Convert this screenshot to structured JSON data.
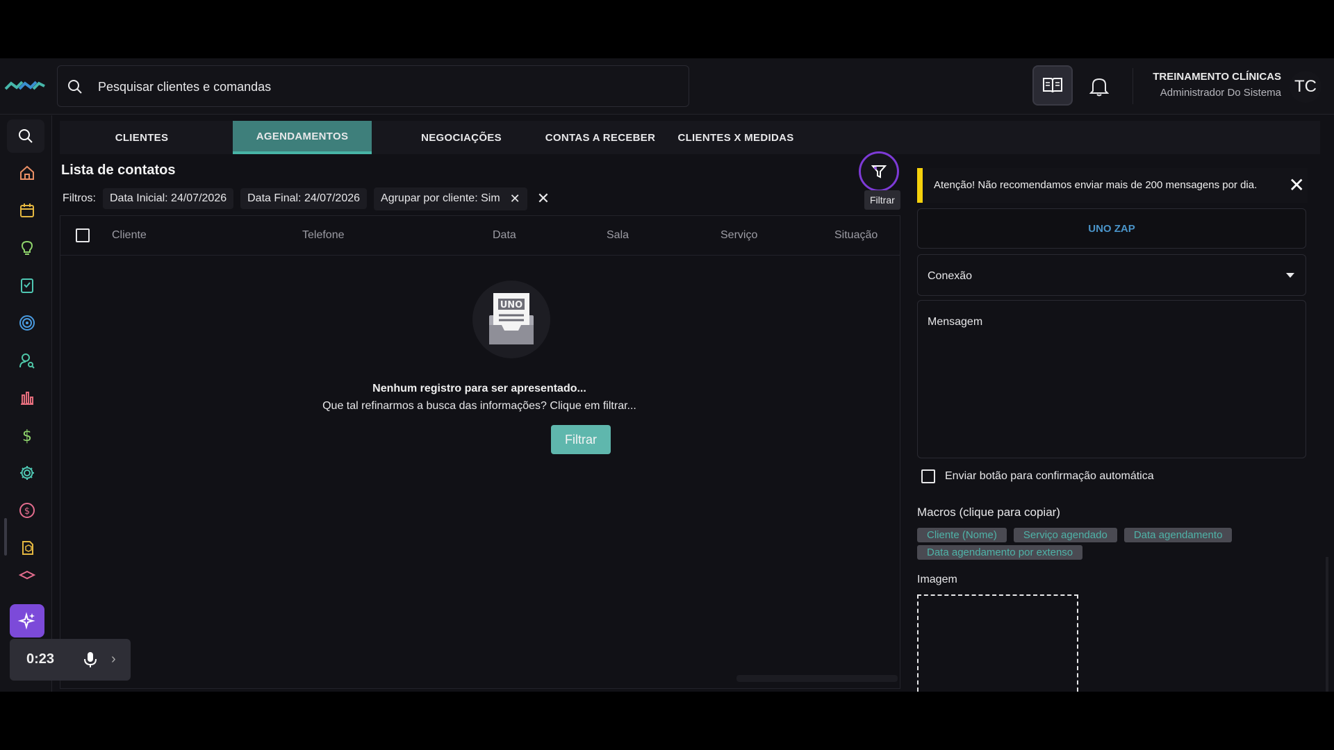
{
  "topbar": {
    "search_placeholder": "Pesquisar clientes e comandas",
    "user_name": "TREINAMENTO CLÍNICAS",
    "user_role": "Administrador Do Sistema",
    "avatar_initials": "TC"
  },
  "sidebar": {
    "items": [
      "search-icon",
      "home-icon",
      "calendar-icon",
      "lightbulb-icon",
      "checklist-icon",
      "target-icon",
      "user-search-icon",
      "bar-chart-icon",
      "dollar-icon",
      "gear-icon",
      "coin-icon",
      "box-icon",
      "cap-icon"
    ],
    "accent": "#7c4ad9"
  },
  "tabs": [
    {
      "label": "CLIENTES",
      "active": false
    },
    {
      "label": "AGENDAMENTOS",
      "active": true
    },
    {
      "label": "NEGOCIAÇÕES",
      "active": false
    },
    {
      "label": "CONTAS A RECEBER",
      "active": false
    },
    {
      "label": "CLIENTES X MEDIDAS",
      "active": false
    }
  ],
  "list": {
    "title": "Lista de contatos",
    "filters_label": "Filtros:",
    "chips": [
      "Data Inicial: 24/07/2026",
      "Data Final: 24/07/2026",
      "Agrupar por cliente: Sim"
    ],
    "filter_tooltip": "Filtrar",
    "columns": [
      "Cliente",
      "Telefone",
      "Data",
      "Sala",
      "Serviço",
      "Situação"
    ],
    "empty_logo": "UNO",
    "empty_title": "Nenhum registro para ser apresentado...",
    "empty_sub": "Que tal refinarmos a busca das informações? Clique em filtrar...",
    "filter_button": "Filtrar"
  },
  "panel": {
    "alert": "Atenção! Não recomendamos enviar mais de 200 mensagens por dia.",
    "alert_color": "#f5d10c",
    "uno_zap": "UNO ZAP",
    "conexao": "Conexão",
    "mensagem": "Mensagem",
    "confirm_label": "Enviar botão para confirmação automática",
    "macros_title": "Macros (clique para copiar)",
    "macros": [
      "Cliente (Nome)",
      "Serviço agendado",
      "Data agendamento",
      "Data agendamento por extenso"
    ],
    "imagem": "Imagem"
  },
  "recorder": {
    "time": "0:23"
  }
}
